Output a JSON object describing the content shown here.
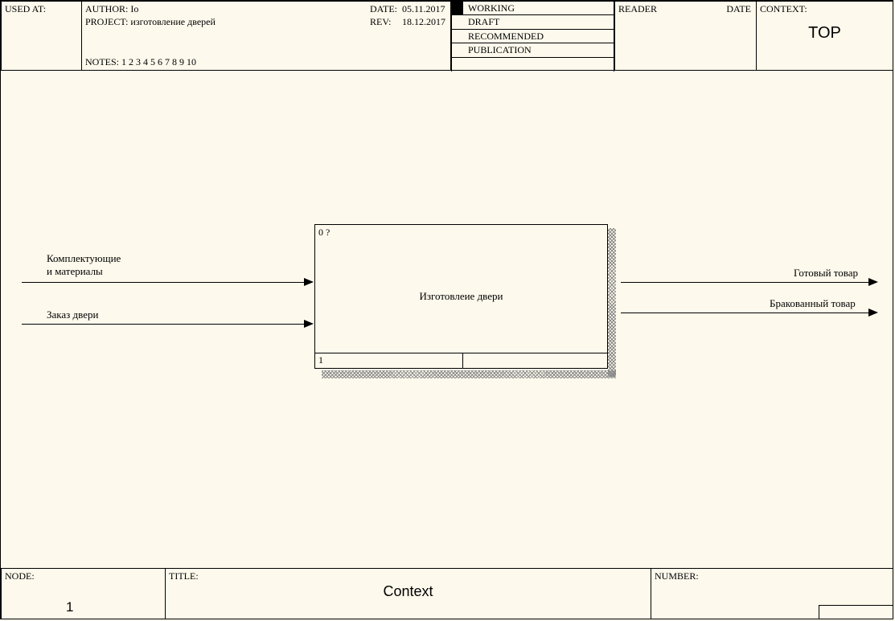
{
  "header": {
    "used_at_label": "USED AT:",
    "author_label": "AUTHOR:",
    "author": "Io",
    "project_label": "PROJECT:",
    "project": "изготовление дверей",
    "date_label": "DATE:",
    "date": "05.11.2017",
    "rev_label": "REV:",
    "rev": "18.12.2017",
    "notes_label": "NOTES:",
    "notes": "1 2 3 4 5 6 7 8 9 10",
    "status": {
      "working": "WORKING",
      "draft": "DRAFT",
      "recommended": "RECOMMENDED",
      "publication": "PUBLICATION"
    },
    "reader_label": "READER",
    "reader_date_label": "DATE",
    "context_label": "CONTEXT:",
    "context_value": "TOP"
  },
  "footer": {
    "node_label": "NODE:",
    "node_value": "1",
    "title_label": "TITLE:",
    "title_value": "Context",
    "number_label": "NUMBER:"
  },
  "diagram": {
    "activity": {
      "top_id": "0 ?",
      "title": "Изготовлеие двери",
      "bottom_id": "1"
    },
    "inputs": [
      {
        "label_line1": "Комплектующие",
        "label_line2": "и материалы"
      },
      {
        "label_line1": "Заказ двери",
        "label_line2": ""
      }
    ],
    "outputs": [
      {
        "label": "Готовый товар"
      },
      {
        "label": "Бракованный товар"
      }
    ]
  }
}
